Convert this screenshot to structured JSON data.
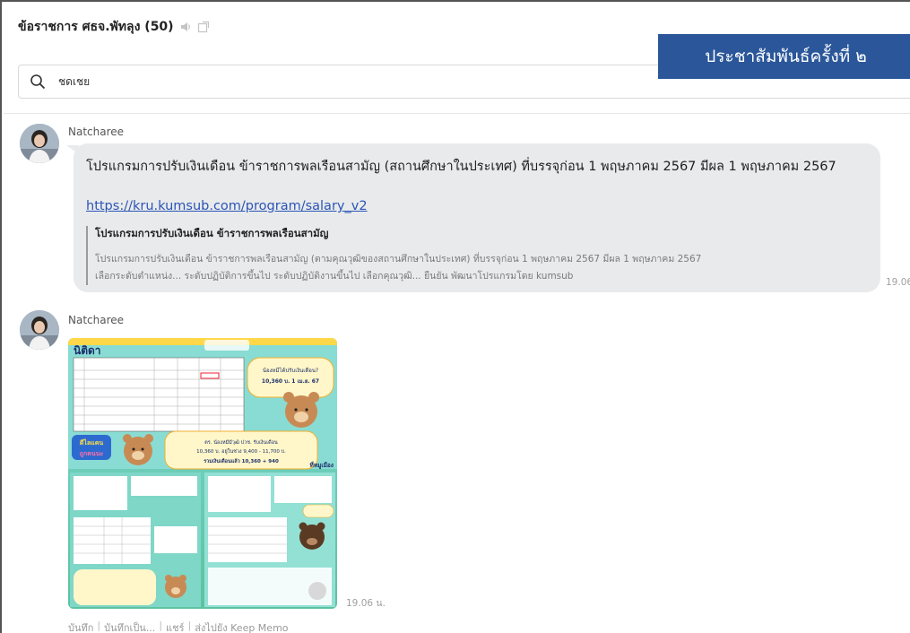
{
  "header": {
    "title": "ข้อราชการ ศธจ.พัทลุง (50)",
    "mute_icon": "speaker-muted-icon",
    "popout_icon": "popout-window-icon"
  },
  "banner": {
    "text": "ประชาสัมพันธ์ครั้งที่ ๒",
    "bg": "#2b579a"
  },
  "search": {
    "icon": "search-icon",
    "value": "ชดเชย"
  },
  "messages": [
    {
      "sender": "Natcharee",
      "text": "โปรแกรมการปรับเงินเดือน ข้าราชการพลเรือนสามัญ (สถานศึกษาในประเทศ) ที่บรรจุก่อน 1 พฤษภาคม 2567 มีผล 1 พฤษภาคม 2567",
      "link": "https://kru.kumsub.com/program/salary_v2",
      "preview_title": "โปรแกรมการปรับเงินเดือน ข้าราชการพลเรือนสามัญ",
      "preview_line1": "โปรแกรมการปรับเงินเดือน ข้าราชการพลเรือนสามัญ (ตามคุณวุฒิของสถานศึกษาในประเทศ) ที่บรรจุก่อน 1 พฤษภาคม 2567 มีผล 1 พฤษภาคม 2567",
      "preview_line2": "เลือกระดับตำแหน่ง... ระดับปฏิบัติการขึ้นไป ระดับปฏิบัติงานขึ้นไป เลือกคุณวุฒิ... ยืนยัน พัฒนาโปรแกรมโดย kumsub",
      "time": "19.06"
    },
    {
      "sender": "Natcharee",
      "image_title": "นิติดา",
      "poster_bubble_1": "น้องหมีได้ปรับเงินเดือน? เงินเดือนน้องหมี 10,360 บ. 1 เม.ย. 67",
      "poster_bubble_2": "ตร. น้องหมีมีวุฒิ ปวช. รับเงินเดือน 10,360 บ. อยู่ในช่วง 9,400 - 11,700 บ. จะได้เพิ่ม 940 บ. เงินที่ได้ปรับขึ้น รวมเงินเดือนแล้ว 10,360 + 940",
      "poster_label_1": "ดีไลแคน",
      "poster_label_2": "ถูกคนนะ",
      "poster_label_3": "ที่หมูเมือง",
      "time": "19.06 น."
    }
  ],
  "actions": [
    "บันทึก",
    "บันทึกเป็น...",
    "แชร์",
    "ส่งไปยัง Keep Memo"
  ]
}
